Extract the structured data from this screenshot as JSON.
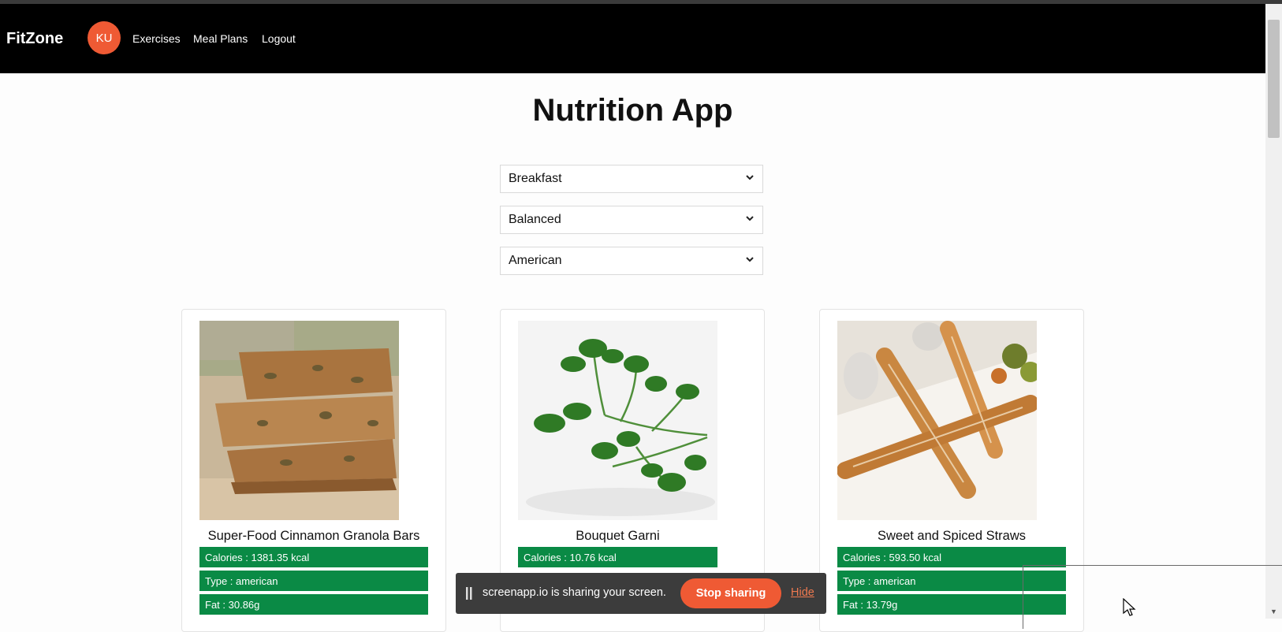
{
  "nav": {
    "brand": "FitZone",
    "avatar_initials": "KU",
    "links": [
      "Exercises",
      "Meal Plans",
      "Logout"
    ]
  },
  "main": {
    "title": "Nutrition App",
    "filters": [
      {
        "name": "meal-type",
        "selected": "Breakfast"
      },
      {
        "name": "diet",
        "selected": "Balanced"
      },
      {
        "name": "cuisine",
        "selected": "American"
      }
    ],
    "cards": [
      {
        "title": "Super-Food Cinnamon Granola Bars",
        "badges": [
          "Calories : 1381.35 kcal",
          "Type : american",
          "Fat : 30.86g"
        ]
      },
      {
        "title": "Bouquet Garni",
        "badges": [
          "Calories : 10.76 kcal"
        ]
      },
      {
        "title": "Sweet and Spiced Straws",
        "badges": [
          "Calories : 593.50 kcal",
          "Type : american",
          "Fat : 13.79g"
        ]
      }
    ]
  },
  "share_bar": {
    "message": "screenapp.io is sharing your screen.",
    "stop_label": "Stop sharing",
    "hide_label": "Hide"
  },
  "colors": {
    "accent": "#ef5a34",
    "badge_green": "#0a8a45",
    "navbar": "#000000"
  }
}
